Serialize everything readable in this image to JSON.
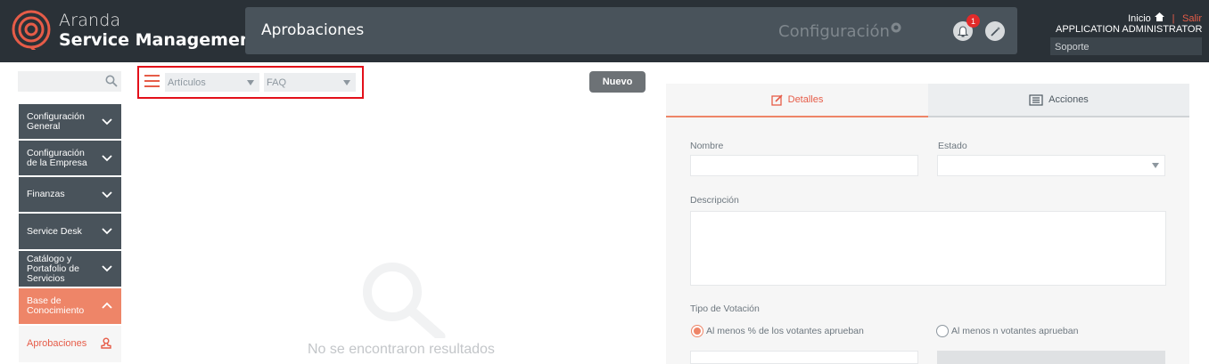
{
  "header": {
    "brand_line1": "Aranda",
    "brand_line2": "Service Management",
    "page_title": "Aprobaciones",
    "config_label": "Configuración",
    "notification_count": "1",
    "inicio": "Inicio",
    "separator": "|",
    "salir": "Salir",
    "user_name": "APPLICATION ADMINISTRATOR",
    "role": "Soporte",
    "accent_color": "#e65c48"
  },
  "sidebar": {
    "search_placeholder": "",
    "items": [
      {
        "label": "Configuración General"
      },
      {
        "label": "Configuración de la Empresa"
      },
      {
        "label": "Finanzas"
      },
      {
        "label": "Service Desk"
      },
      {
        "label": "Catálogo y Portafolio de Servicios"
      },
      {
        "label": "Base de Conocimiento"
      }
    ],
    "sub_item": "Aprobaciones"
  },
  "filters": {
    "type_value": "Artículos",
    "category_value": "FAQ"
  },
  "actions": {
    "new_label": "Nuevo"
  },
  "results": {
    "empty_text": "No se encontraron resultados"
  },
  "panel": {
    "tabs": [
      {
        "label": "Detalles",
        "icon": "edit-icon"
      },
      {
        "label": "Acciones",
        "icon": "actions-icon"
      }
    ],
    "name_label": "Nombre",
    "name_value": "",
    "state_label": "Estado",
    "state_value": "",
    "description_label": "Descripción",
    "description_value": "",
    "vote_type_label": "Tipo de Votación",
    "vote_options": [
      {
        "label": "Al menos % de los votantes aprueban",
        "selected": true
      },
      {
        "label": "Al menos n votantes aprueban",
        "selected": false
      }
    ]
  }
}
